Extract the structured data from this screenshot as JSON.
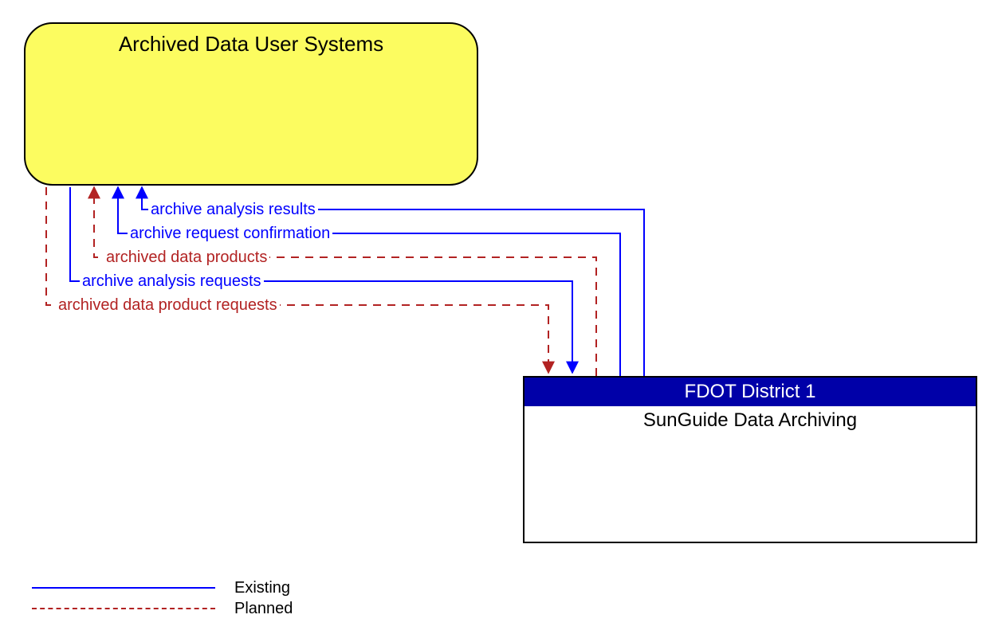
{
  "nodes": {
    "user_systems": {
      "title": "Archived Data User Systems"
    },
    "fdot": {
      "header": "FDOT District 1",
      "body": "SunGuide Data Archiving"
    }
  },
  "flows": {
    "f1": {
      "label": "archive analysis results",
      "status": "existing",
      "direction": "to_user"
    },
    "f2": {
      "label": "archive request confirmation",
      "status": "existing",
      "direction": "to_user"
    },
    "f3": {
      "label": "archived data products",
      "status": "planned",
      "direction": "to_user"
    },
    "f4": {
      "label": "archive analysis requests",
      "status": "existing",
      "direction": "to_fdot"
    },
    "f5": {
      "label": "archived data product requests",
      "status": "planned",
      "direction": "to_fdot"
    }
  },
  "legend": {
    "existing": "Existing",
    "planned": "Planned"
  }
}
